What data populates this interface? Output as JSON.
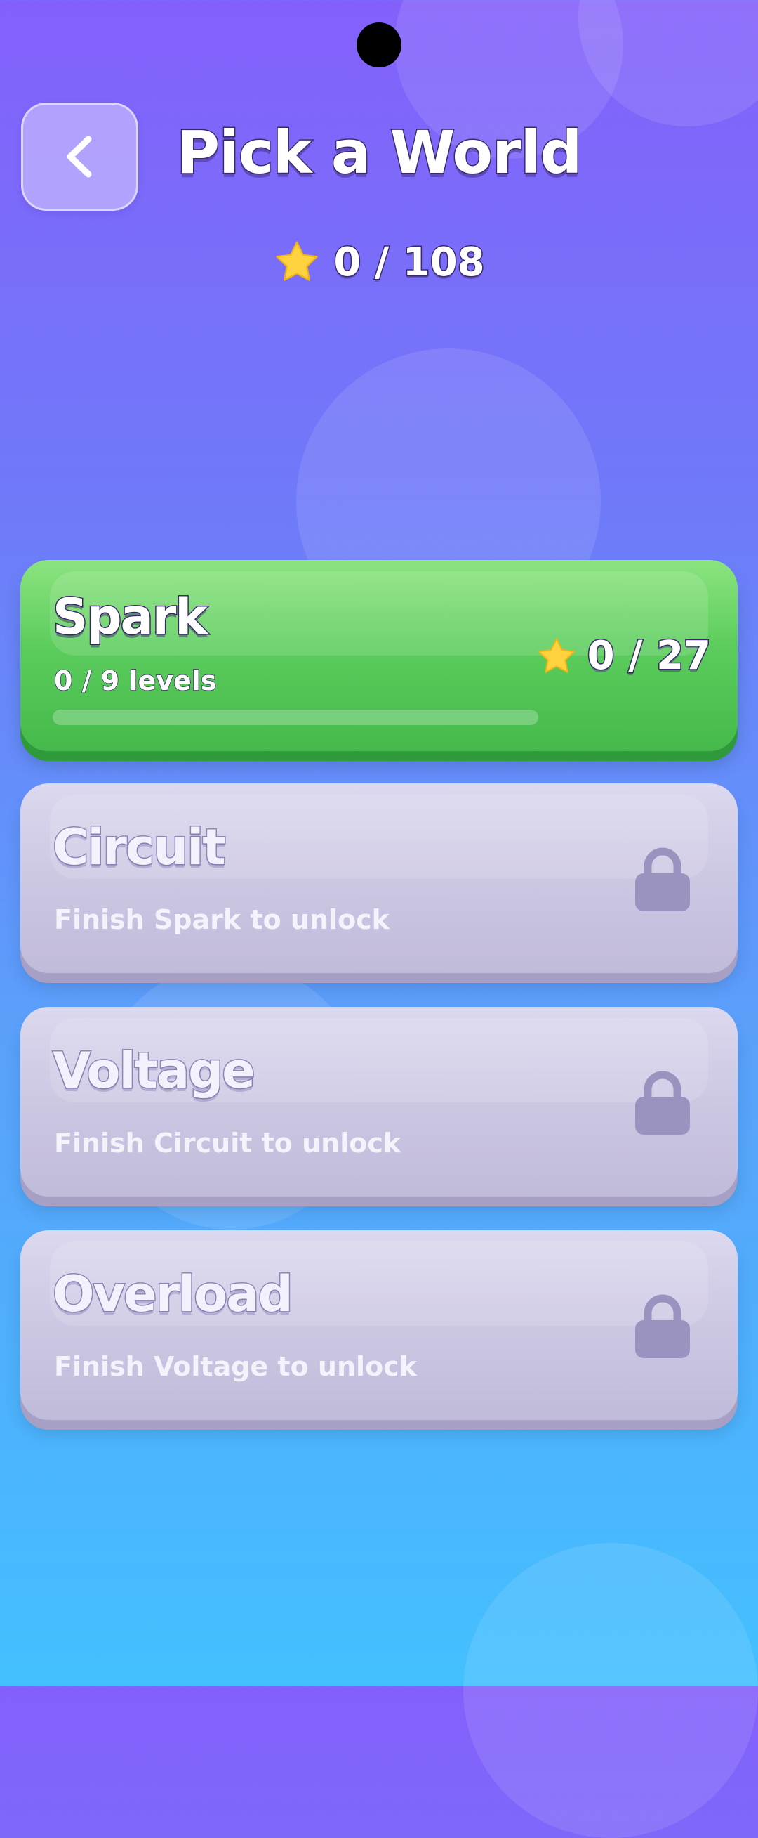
{
  "header": {
    "title": "Pick a World",
    "back_icon": "chevron-left-icon"
  },
  "total_stars": {
    "icon": "star-icon",
    "text": "0 / 108",
    "earned": 0,
    "total": 108
  },
  "colors": {
    "star": "#ffd23f",
    "unlocked_card": "#5ccd5d",
    "locked_card": "#ccc7e3",
    "lock": "#9a93c0",
    "text_outline": "#3b2a6b"
  },
  "worlds": [
    {
      "name": "Spark",
      "status": "unlocked",
      "levels_text": "0 / 9 levels",
      "levels_done": 0,
      "levels_total": 9,
      "progress_fraction": 0,
      "stars_text": "0 / 27",
      "stars_icon": "star-icon"
    },
    {
      "name": "Circuit",
      "status": "locked",
      "unlock_text": "Finish Spark to unlock",
      "lock_icon": "lock-icon"
    },
    {
      "name": "Voltage",
      "status": "locked",
      "unlock_text": "Finish Circuit to unlock",
      "lock_icon": "lock-icon"
    },
    {
      "name": "Overload",
      "status": "locked",
      "unlock_text": "Finish Voltage to unlock",
      "lock_icon": "lock-icon"
    }
  ]
}
